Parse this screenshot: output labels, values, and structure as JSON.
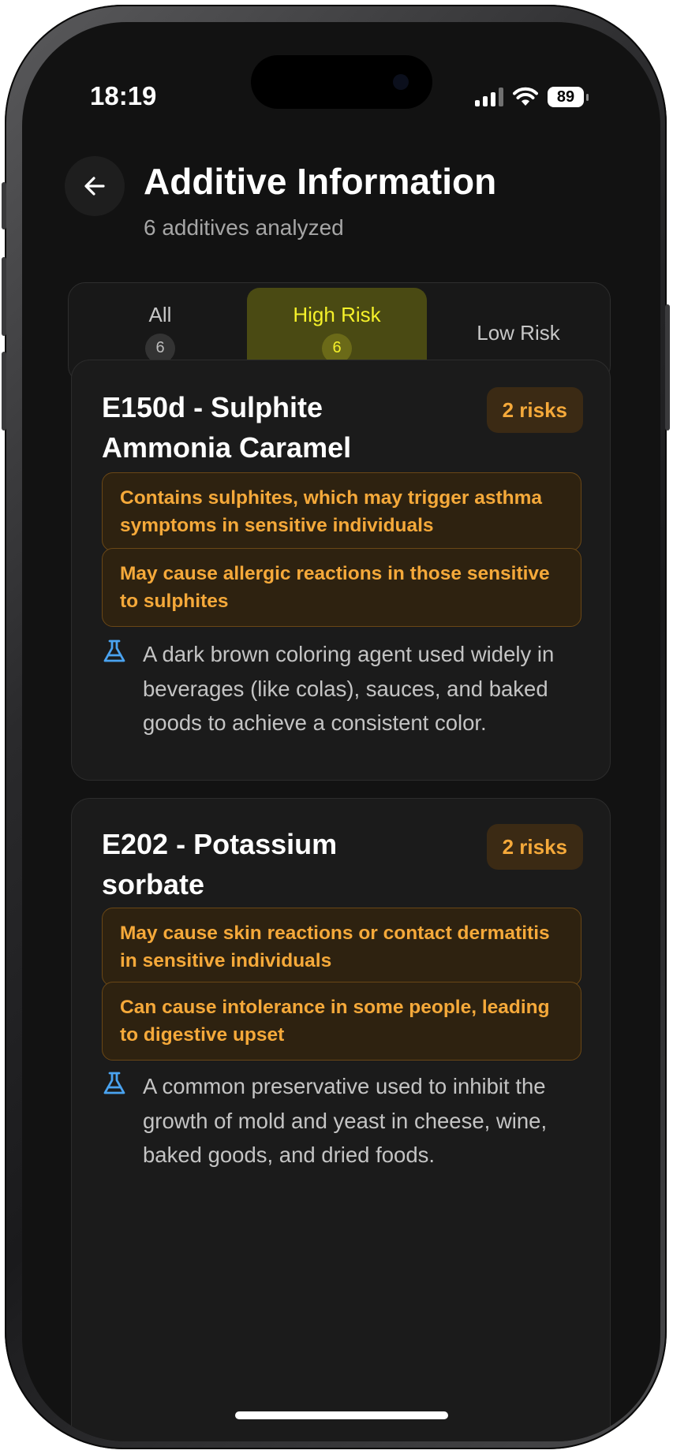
{
  "status_bar": {
    "time": "18:19",
    "battery": "89",
    "signal_icon": "cellular-signal-icon",
    "wifi_icon": "wifi-icon"
  },
  "header": {
    "back_icon": "arrow-left-icon",
    "title": "Additive Information",
    "subtitle": "6 additives analyzed"
  },
  "filter": {
    "tabs": [
      {
        "label": "All",
        "count": "6",
        "selected": false
      },
      {
        "label": "High Risk",
        "count": "6",
        "selected": true
      },
      {
        "label": "Low Risk",
        "count": "",
        "selected": false
      }
    ]
  },
  "additives": [
    {
      "title": "E150d - Sulphite Ammonia Caramel",
      "risk_badge": "2 risks",
      "risks": [
        "Contains sulphites, which may trigger asthma symptoms in sensitive individuals",
        "May cause allergic reactions in those sensitive to sulphites"
      ],
      "description": "A dark brown coloring agent used widely in beverages (like colas), sauces, and baked goods to achieve a consistent color.",
      "description_icon": "flask-icon"
    },
    {
      "title": "E202 - Potassium sorbate",
      "risk_badge": "2 risks",
      "risks": [
        "May cause skin reactions or contact dermatitis in sensitive individuals",
        "Can cause intolerance in some people, leading to digestive upset"
      ],
      "description": "A common preservative used to inhibit the growth of mold and yeast in cheese, wine, baked goods, and dried foods.",
      "description_icon": "flask-icon"
    }
  ],
  "colors": {
    "background": "#121212",
    "accent_selected": "#f5f12a",
    "risk_text": "#f5a93a",
    "flask_icon": "#4aa3f0"
  }
}
